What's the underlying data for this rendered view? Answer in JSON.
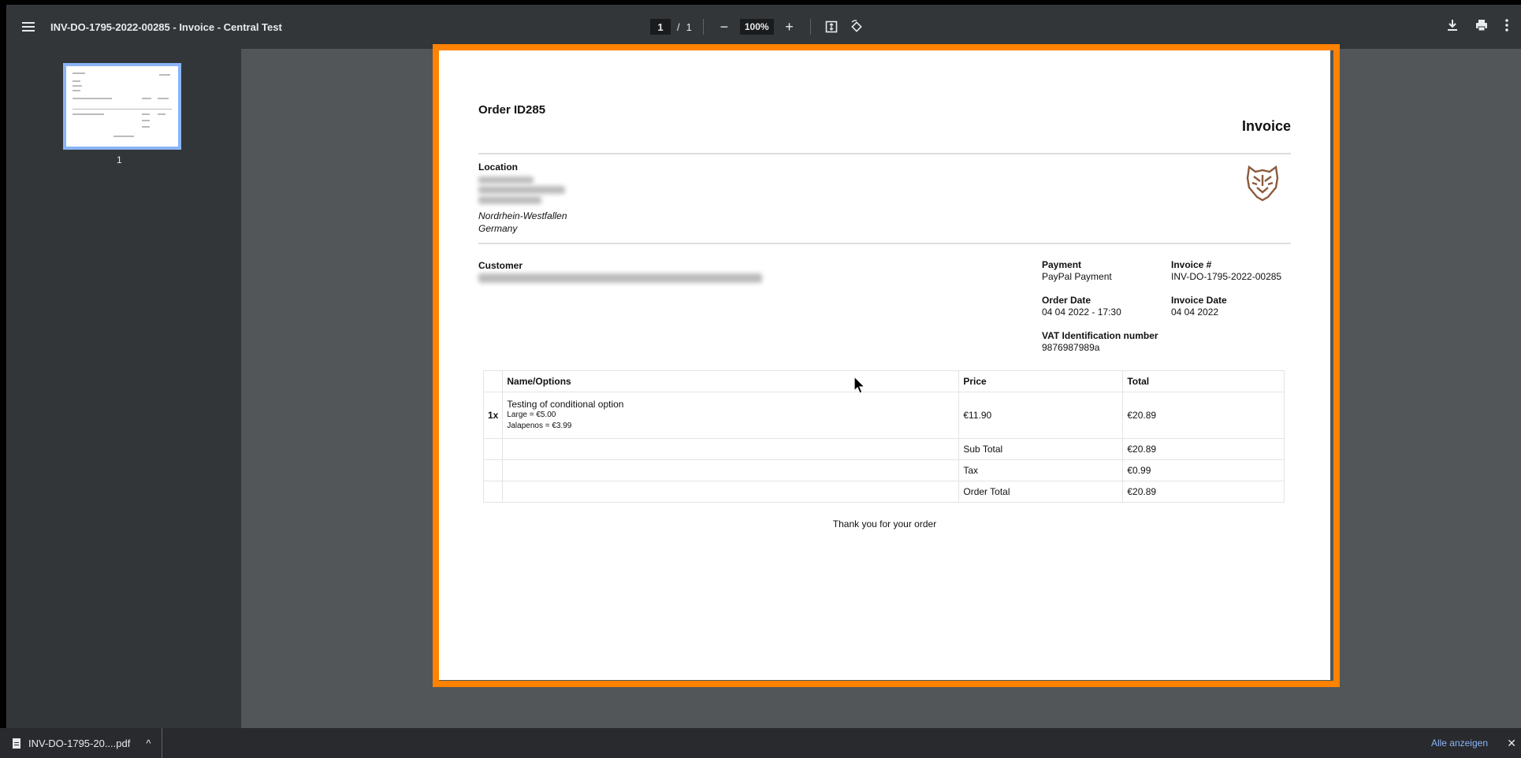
{
  "toolbar": {
    "title": "INV-DO-1795-2022-00285 - Invoice - Central Test",
    "page_current": "1",
    "page_sep": "/",
    "page_total": "1",
    "zoom": "100%",
    "zoom_out": "−",
    "zoom_in": "+"
  },
  "sidebar": {
    "thumb_number": "1"
  },
  "invoice": {
    "order_id": "Order ID285",
    "heading": "Invoice",
    "location_label": "Location",
    "location_state": "Nordrhein-Westfallen",
    "location_country": "Germany",
    "customer_label": "Customer",
    "payment_label": "Payment",
    "payment_value": "PayPal Payment",
    "invoice_no_label": "Invoice #",
    "invoice_no_value": "INV-DO-1795-2022-00285",
    "order_date_label": "Order Date",
    "order_date_value": "04 04 2022 - 17:30",
    "invoice_date_label": "Invoice Date",
    "invoice_date_value": "04 04 2022",
    "vat_label": "VAT Identification number",
    "vat_value": "9876987989a",
    "table": {
      "headers": {
        "name": "Name/Options",
        "price": "Price",
        "total": "Total"
      },
      "item": {
        "qty": "1x",
        "name": "Testing of conditional option",
        "option1": "Large = €5.00",
        "option2": "Jalapenos = €3.99",
        "price": "€11.90",
        "total": "€20.89"
      },
      "subtotal_label": "Sub Total",
      "subtotal_value": "€20.89",
      "tax_label": "Tax",
      "tax_value": "€0.99",
      "order_total_label": "Order Total",
      "order_total_value": "€20.89"
    },
    "thanks": "Thank you for your order"
  },
  "download_bar": {
    "filename": "INV-DO-1795-20....pdf",
    "chevron": "^",
    "show_all": "Alle anzeigen",
    "close": "✕"
  },
  "icons": {
    "menu": "hamburger-icon",
    "fit": "fit-to-page-icon",
    "rotate": "rotate-icon",
    "download": "download-icon",
    "print": "print-icon",
    "more": "more-vert-icon",
    "logo": "tiger-logo-icon"
  },
  "colors": {
    "highlight": "#ff8200",
    "toolbar": "#323639",
    "viewer": "#525659",
    "link": "#8ab4f8"
  }
}
